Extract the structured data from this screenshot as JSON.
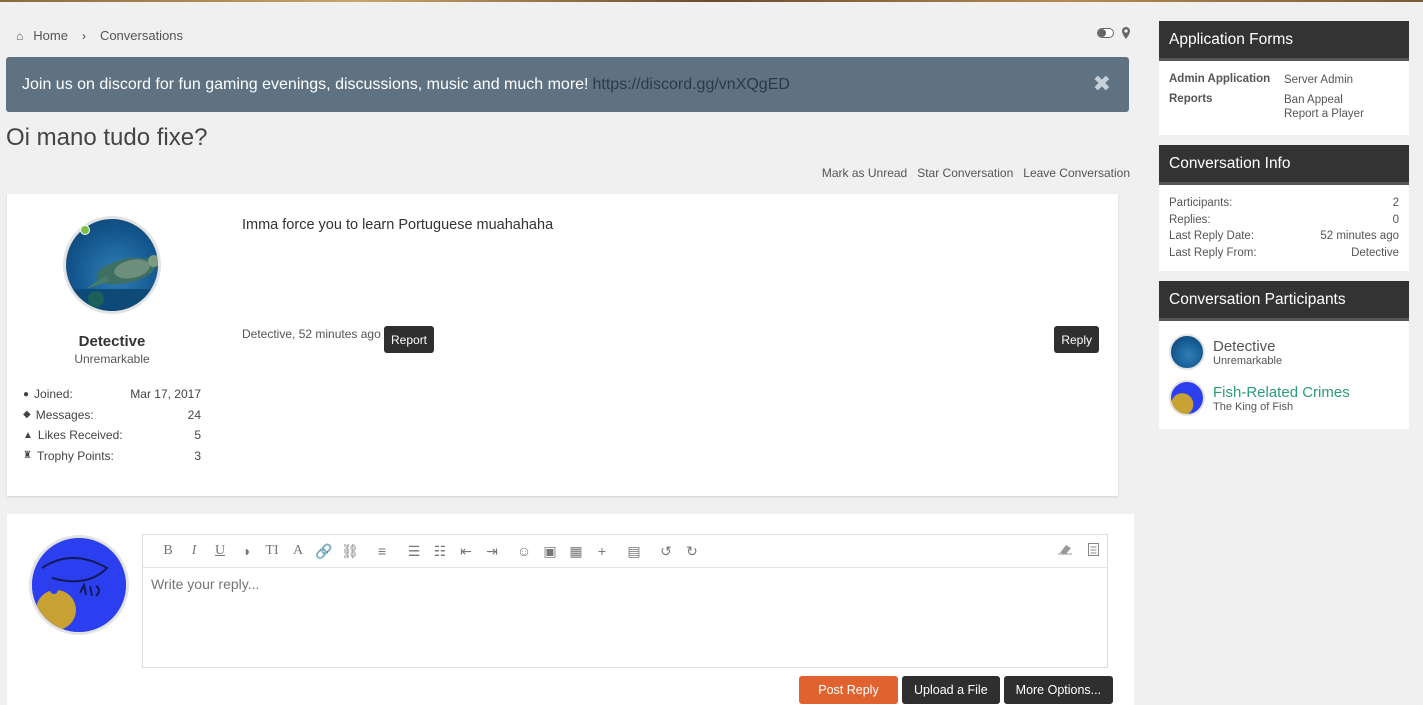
{
  "breadcrumb": {
    "home": "Home",
    "current": "Conversations"
  },
  "notice": {
    "text": "Join us on discord for fun gaming evenings, discussions, music and much more!",
    "link": "https://discord.gg/vnXQgED",
    "close": "✖"
  },
  "page_title": "Oi mano tudo fixe?",
  "actions": {
    "mark_unread": "Mark as Unread",
    "star": "Star Conversation",
    "leave": "Leave Conversation"
  },
  "post": {
    "author": "Detective",
    "user_title": "Unremarkable",
    "stats": [
      {
        "label": "Joined:",
        "value": "Mar 17, 2017",
        "icon": "user-icon"
      },
      {
        "label": "Messages:",
        "value": "24",
        "icon": "messages-icon"
      },
      {
        "label": "Likes Received:",
        "value": "5",
        "icon": "thumbs-up-icon"
      },
      {
        "label": "Trophy Points:",
        "value": "3",
        "icon": "trophy-icon"
      }
    ],
    "message": "Imma force you to learn Portuguese muahahaha",
    "meta": "Detective, 52 minutes ago",
    "report_label": "Report",
    "reply_label": "Reply"
  },
  "editor": {
    "placeholder": "Write your reply...",
    "toolbar": [
      "B",
      "I",
      "U",
      "◑",
      "TI",
      "A",
      "🔗",
      "⛓",
      "≡",
      "☰",
      "☷",
      "⇤",
      "⇥",
      "☺",
      "▣",
      "▦",
      "+",
      "▤",
      "↺",
      "↻"
    ],
    "post_reply": "Post Reply",
    "upload": "Upload a File",
    "more": "More Options..."
  },
  "sidebar": {
    "forms": {
      "title": "Application Forms",
      "rows": [
        {
          "key": "Admin Application",
          "values": [
            "Server Admin"
          ]
        },
        {
          "key": "Reports",
          "values": [
            "Ban Appeal",
            "Report a Player"
          ]
        }
      ]
    },
    "info": {
      "title": "Conversation Info",
      "rows": [
        {
          "k": "Participants:",
          "v": "2"
        },
        {
          "k": "Replies:",
          "v": "0"
        },
        {
          "k": "Last Reply Date:",
          "v": "52 minutes ago"
        },
        {
          "k": "Last Reply From:",
          "v": "Detective"
        }
      ]
    },
    "participants": {
      "title": "Conversation Participants",
      "list": [
        {
          "name": "Detective",
          "title": "Unremarkable"
        },
        {
          "name": "Fish-Related Crimes",
          "title": "The King of Fish"
        }
      ]
    }
  },
  "colors": {
    "notice_bg": "#5f7282",
    "accent_orange": "#e0622f",
    "dark_header": "#333333",
    "participant_green": "#2d9b7d"
  }
}
